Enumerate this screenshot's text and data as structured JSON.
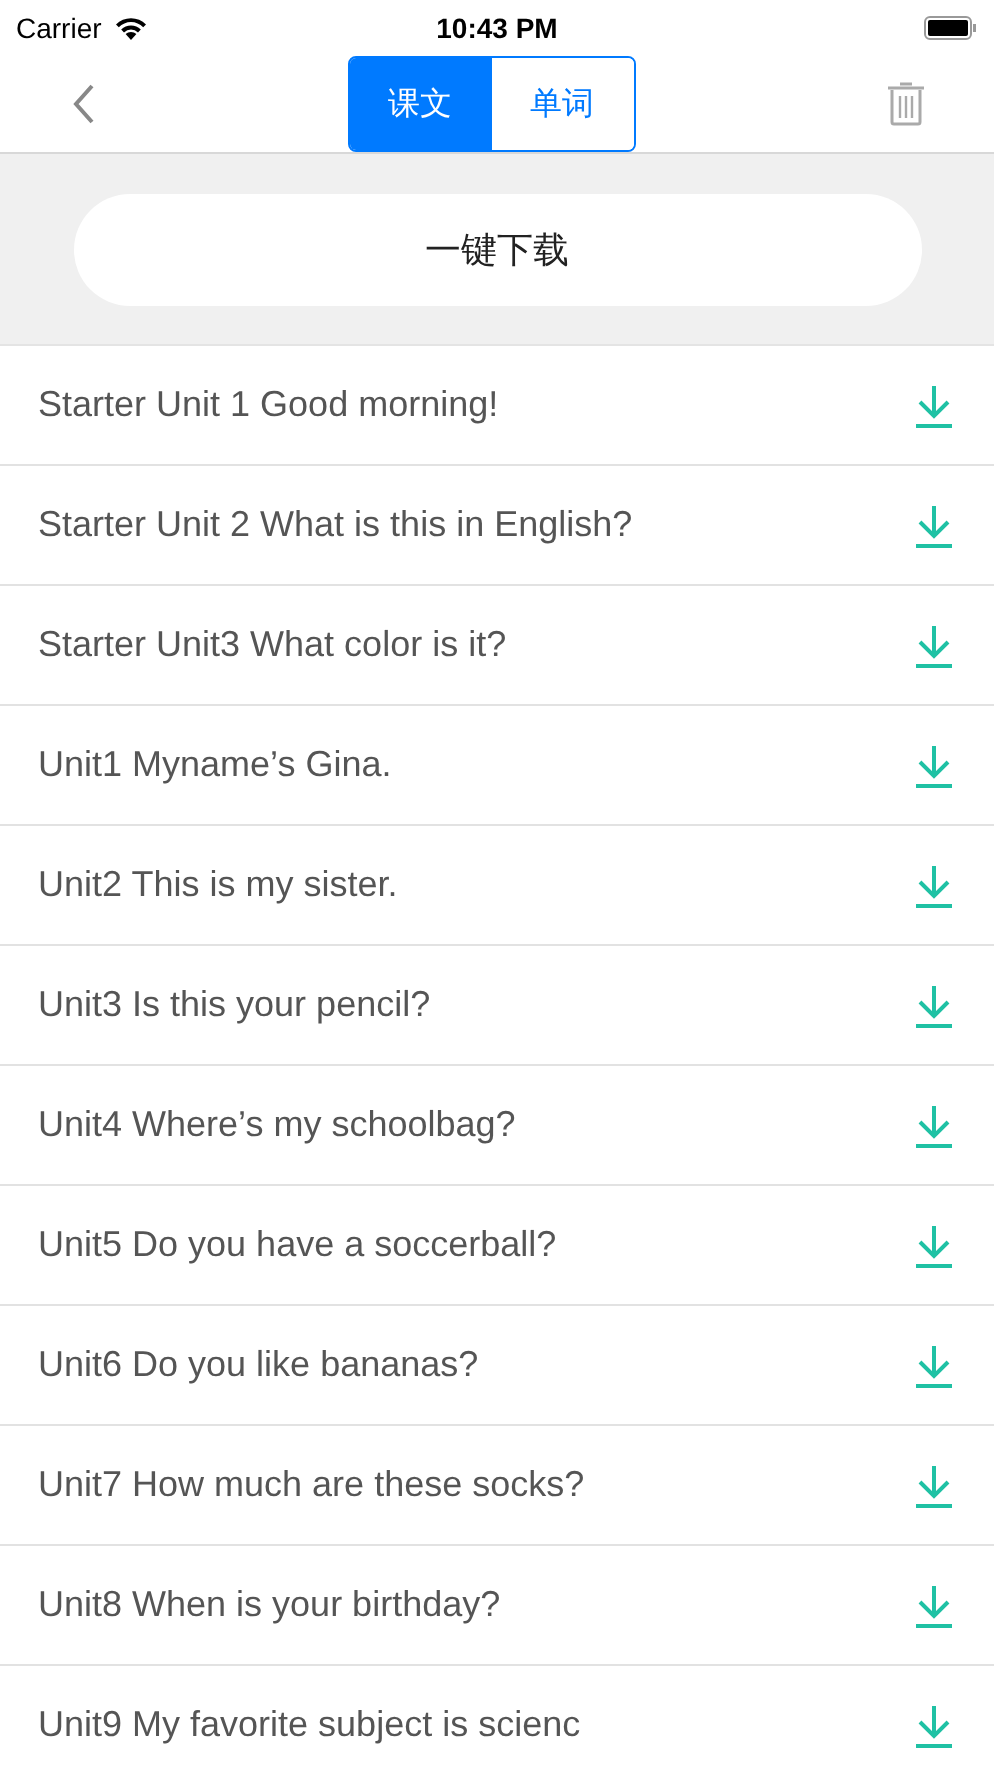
{
  "status_bar": {
    "carrier": "Carrier",
    "time": "10:43 PM"
  },
  "tabs": [
    {
      "label": "课文",
      "selected": true
    },
    {
      "label": "单词",
      "selected": false
    }
  ],
  "download_all_button": "一键下载",
  "lessons": [
    {
      "title": "Starter Unit 1 Good morning!"
    },
    {
      "title": "Starter Unit 2 What is this in English?"
    },
    {
      "title": "Starter Unit3 What color is it?"
    },
    {
      "title": "Unit1 Myname’s Gina."
    },
    {
      "title": "Unit2 This is my sister."
    },
    {
      "title": "Unit3 Is this your pencil?"
    },
    {
      "title": "Unit4 Where’s my schoolbag?"
    },
    {
      "title": "Unit5 Do you have a soccerball?"
    },
    {
      "title": "Unit6 Do you like bananas?"
    },
    {
      "title": "Unit7 How much are these socks?"
    },
    {
      "title": "Unit8 When is your birthday?"
    },
    {
      "title": "Unit9 My favorite subject is scienc"
    }
  ]
}
